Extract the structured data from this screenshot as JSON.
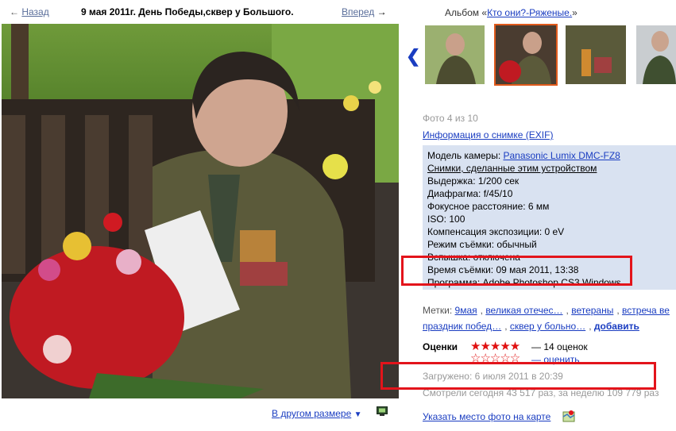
{
  "nav": {
    "back_arrow": "←",
    "back_label": "Назад",
    "title": "9 мая 2011г. День Победы,сквер у Большого.",
    "forward_label": "Вперед",
    "forward_arrow": "→"
  },
  "album": {
    "prefix": "Альбом «",
    "name": "Кто они?-Ряженые.",
    "suffix": "»",
    "prev_icon": "❮"
  },
  "photo": {
    "counter": "Фото 4 из 10",
    "exif_link": "Информация о снимке (EXIF)"
  },
  "exif": {
    "camera_label": "Модель камеры: ",
    "camera_value": "Panasonic Lumix DMC-FZ8",
    "device_link": "Снимки, сделанные этим устройством",
    "rows": [
      "Выдержка: 1/200 сек",
      "Диафрагма: f/45/10",
      "Фокусное расстояние: 6 мм",
      "ISO: 100",
      "Компенсация экспозиции: 0 eV",
      "Режим съёмки: обычный",
      "Вспышка: отключена",
      "Время съёмки: 09 мая 2011, 13:38",
      "Программа: Adobe Photoshop CS3 Windows"
    ]
  },
  "tags": {
    "label": "Метки: ",
    "items": [
      "9мая",
      "великая отечес…",
      "ветераны",
      "встреча ве",
      "праздник побед…",
      "сквер у больно…"
    ],
    "add": "добавить"
  },
  "ratings": {
    "label": "Оценки",
    "stars": "★★★★★",
    "stars_empty": "☆☆☆☆☆",
    "count": "— 14 оценок",
    "rate": "— оценить"
  },
  "uploaded": "Загружено: 6 июля 2011 в 20:39",
  "views": "Смотрели сегодня 43 517 раз, за неделю 109 779 раз",
  "map_link": "Указать место фото на карте",
  "resize": {
    "label": "В другом размере",
    "caret": "▼"
  },
  "colors": {
    "link": "#1a3dc1",
    "highlight_box": "#e3141b",
    "exif_bg": "#d9e2f1",
    "star": "#e01010"
  }
}
